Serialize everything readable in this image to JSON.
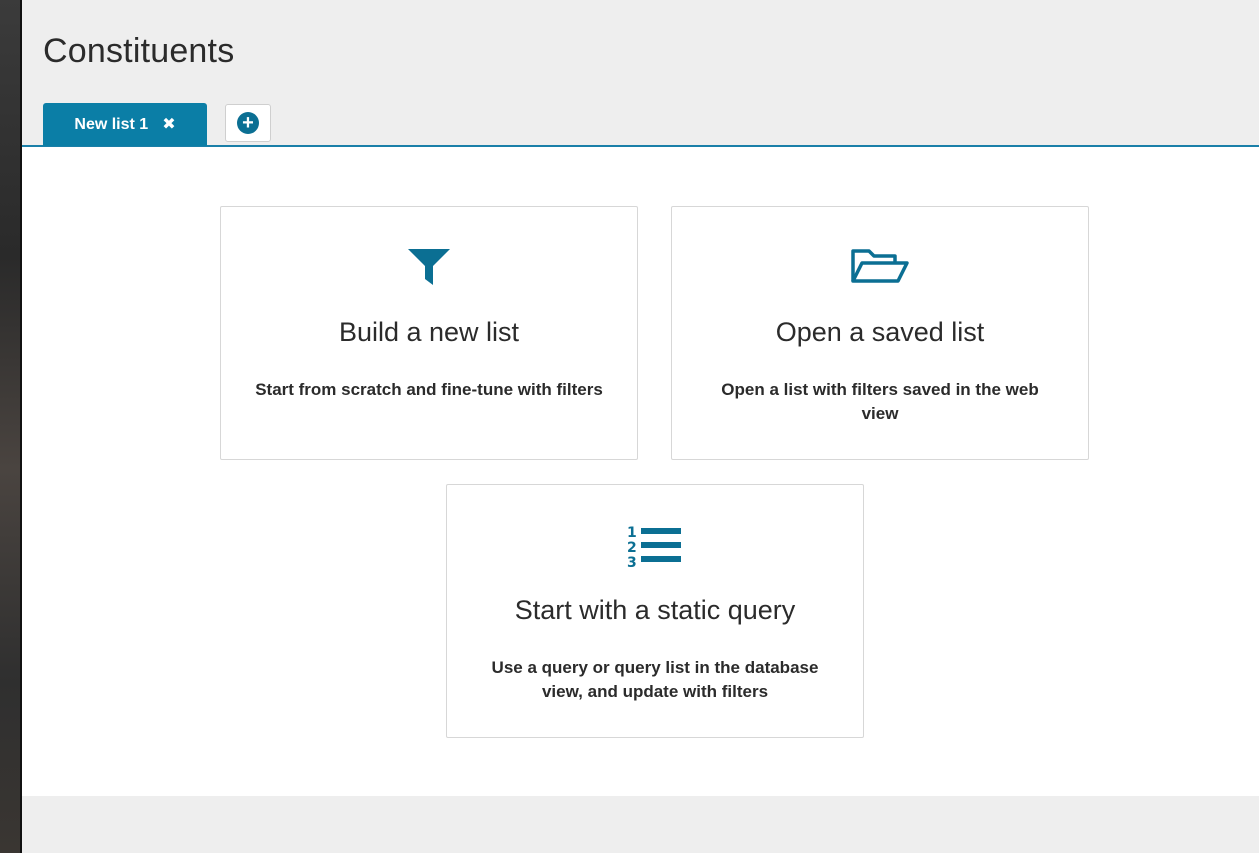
{
  "page": {
    "title": "Constituents"
  },
  "tabs": {
    "active": {
      "label": "New list 1",
      "close_glyph": "✖"
    },
    "add_glyph": "+"
  },
  "cards": [
    {
      "icon": "filter-icon",
      "title": "Build a new list",
      "description": "Start from scratch and fine-tune with filters"
    },
    {
      "icon": "folder-open-icon",
      "title": "Open a saved list",
      "description": "Open a list with filters saved in the web view"
    },
    {
      "icon": "numbered-list-icon",
      "title": "Start with a static query",
      "description": "Use a query or query list in the database view, and update with filters"
    }
  ],
  "colors": {
    "accent": "#0b7ea6",
    "header_bg": "#eeeeee",
    "card_border": "#d7d7d7"
  }
}
